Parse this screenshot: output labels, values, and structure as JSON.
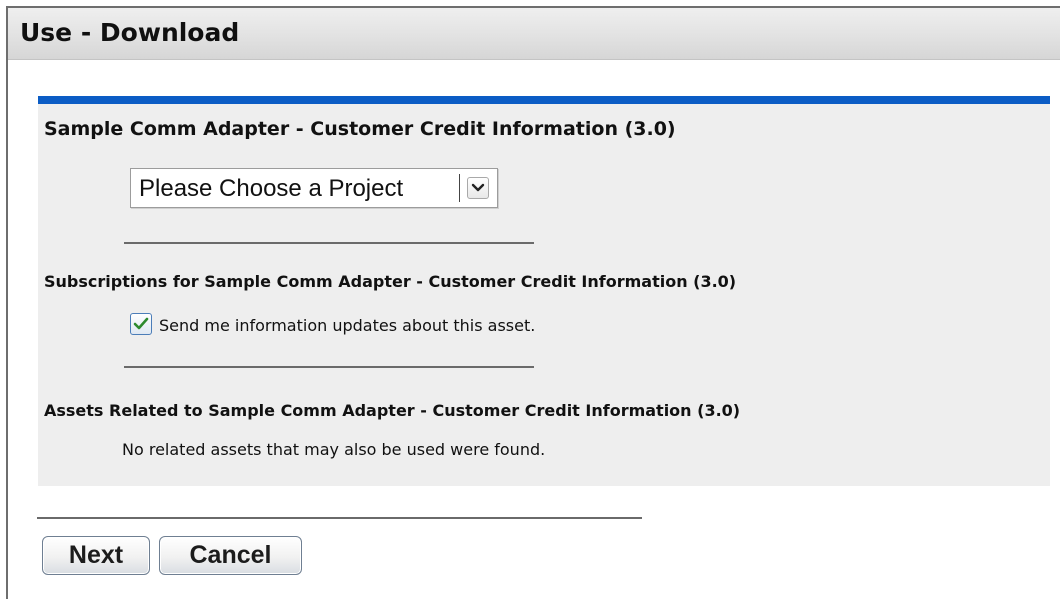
{
  "window": {
    "title": "Use - Download"
  },
  "asset": {
    "name": "Sample Comm Adapter - Customer Credit Information (3.0)"
  },
  "project_select": {
    "selected": "Please Choose a Project",
    "icon": "chevron-down-icon"
  },
  "subscriptions": {
    "heading": "Subscriptions for Sample Comm Adapter - Customer Credit Information (3.0)",
    "checkbox_label": "Send me information updates about this asset.",
    "checked": true,
    "check_color": "#2e8b2e"
  },
  "related": {
    "heading": "Assets Related to Sample Comm Adapter - Customer Credit Information (3.0)",
    "message": "No related assets that may also be used were found."
  },
  "buttons": {
    "next": "Next",
    "cancel": "Cancel"
  },
  "colors": {
    "accent_bar": "#0b5cc5",
    "panel_bg": "#eeeeee",
    "titlebar_bg": "#e2e2e2"
  }
}
